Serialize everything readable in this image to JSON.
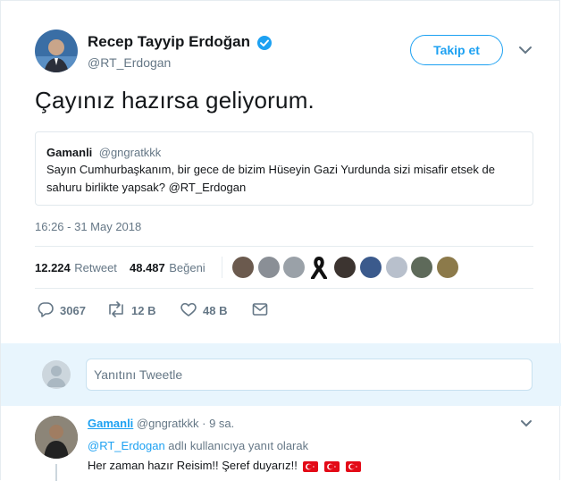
{
  "author": {
    "name": "Recep Tayyip Erdoğan",
    "handle": "@RT_Erdogan",
    "verified_icon": "verified-badge-icon"
  },
  "follow_label": "Takip et",
  "tweet_text": "Çayınız hazırsa geliyorum.",
  "quoted": {
    "name": "Gamanli",
    "handle": "@gngratkkk",
    "text": "Sayın Cumhurbaşkanım, bir gece de bizim Hüseyin Gazi Yurdunda sizi misafir etsek de sahuru birlikte yapsak? @RT_Erdogan"
  },
  "timestamp": "16:26 - 31 May 2018",
  "stats": {
    "retweets_count": "12.224",
    "retweets_label": "Retweet",
    "likes_count": "48.487",
    "likes_label": "Beğeni"
  },
  "actions": {
    "reply_count": "3067",
    "retweet_count": "12 B",
    "like_count": "48 B"
  },
  "reply_input": {
    "placeholder": "Yanıtını Tweetle"
  },
  "reply": {
    "name": "Gamanli",
    "handle": "@gngratkkk",
    "separator": "·",
    "time": "9 sa.",
    "replying_to_handle": "@RT_Erdogan",
    "replying_to_suffix": "adlı kullanıcıya yanıt olarak",
    "text": "Her zaman hazır Reisim!! Şeref duyarız!!"
  },
  "colors": {
    "accent": "#1da1f2",
    "muted": "#657786",
    "flag_red": "#e30a17"
  }
}
